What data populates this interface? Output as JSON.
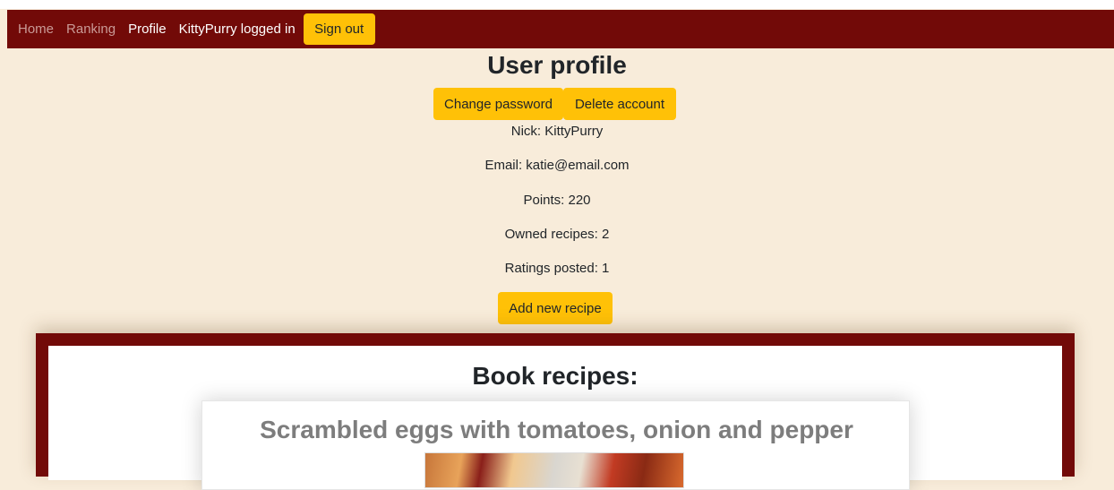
{
  "nav": {
    "home": "Home",
    "ranking": "Ranking",
    "profile": "Profile",
    "user_status": "KittyPurry logged in",
    "signout": "Sign out"
  },
  "profile": {
    "title": "User profile",
    "change_password": "Change password",
    "delete_account": "Delete account",
    "nick": "Nick: KittyPurry",
    "email": "Email: katie@email.com",
    "points": "Points: 220",
    "owned_recipes": "Owned recipes: 2",
    "ratings_posted": "Ratings posted: 1",
    "add_recipe": "Add new recipe"
  },
  "book": {
    "title": "Book recipes:",
    "recipes": [
      {
        "title": "Scrambled eggs with tomatoes, onion and pepper"
      }
    ]
  },
  "colors": {
    "navbar": "#720a08",
    "page_background": "#f8ecda",
    "button": "#ffc107"
  }
}
